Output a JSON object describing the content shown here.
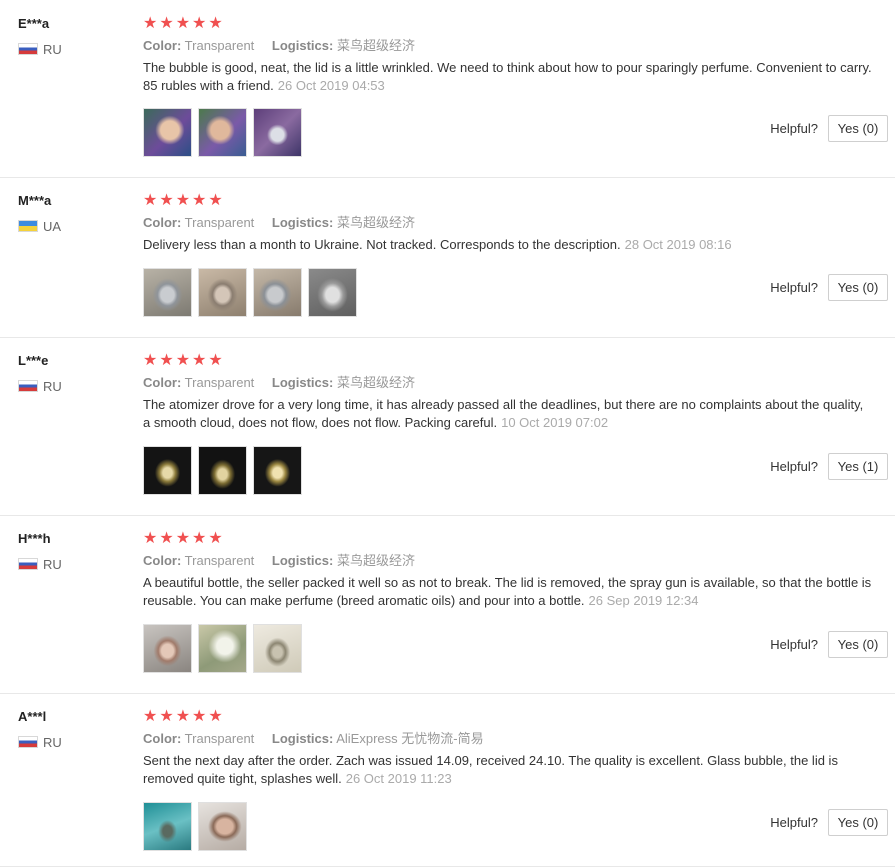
{
  "labels": {
    "color": "Color:",
    "logistics": "Logistics:",
    "helpful": "Helpful?"
  },
  "colors": {
    "star": "#f05050",
    "text": "#333333",
    "muted": "#999999",
    "border": "#e8e8e8"
  },
  "reviews": [
    {
      "user": "E***a",
      "country": "RU",
      "flag": "ru-flag-icon",
      "stars": "★★★★★",
      "rating": 5,
      "color": "Transparent",
      "logistics": "菜鸟超级经济",
      "text": "The bubble is good, neat, the lid is a little wrinkled. We need to think about how to pour sparingly perfume. Convenient to carry. 85 rubles with a friend.",
      "date": "26 Oct 2019 04:53",
      "yes": "Yes (0)",
      "photos": 3
    },
    {
      "user": "M***a",
      "country": "UA",
      "flag": "ua-flag-icon",
      "stars": "★★★★★",
      "rating": 5,
      "color": "Transparent",
      "logistics": "菜鸟超级经济",
      "text": "Delivery less than a month to Ukraine. Not tracked. Corresponds to the description.",
      "date": "28 Oct 2019 08:16",
      "yes": "Yes (0)",
      "photos": 4
    },
    {
      "user": "L***e",
      "country": "RU",
      "flag": "ru-flag-icon",
      "stars": "★★★★★",
      "rating": 5,
      "color": "Transparent",
      "logistics": "菜鸟超级经济",
      "text": "The atomizer drove for a very long time, it has already passed all the deadlines, but there are no complaints about the quality, a smooth cloud, does not flow, does not flow. Packing careful.",
      "date": "10 Oct 2019 07:02",
      "yes": "Yes (1)",
      "photos": 3
    },
    {
      "user": "H***h",
      "country": "RU",
      "flag": "ru-flag-icon",
      "stars": "★★★★★",
      "rating": 5,
      "color": "Transparent",
      "logistics": "菜鸟超级经济",
      "text": "A beautiful bottle, the seller packed it well so as not to break. The lid is removed, the spray gun is available, so that the bottle is reusable. You can make perfume (breed aromatic oils) and pour into a bottle.",
      "date": "26 Sep 2019 12:34",
      "yes": "Yes (0)",
      "photos": 3
    },
    {
      "user": "A***l",
      "country": "RU",
      "flag": "ru-flag-icon",
      "stars": "★★★★★",
      "rating": 5,
      "color": "Transparent",
      "logistics": "AliExpress 无忧物流-简易",
      "text": "Sent the next day after the order. Zach was issued 14.09, received 24.10. The quality is excellent. Glass bubble, the lid is removed quite tight, splashes well.",
      "date": "26 Oct 2019 11:23",
      "yes": "Yes (0)",
      "photos": 2
    }
  ]
}
